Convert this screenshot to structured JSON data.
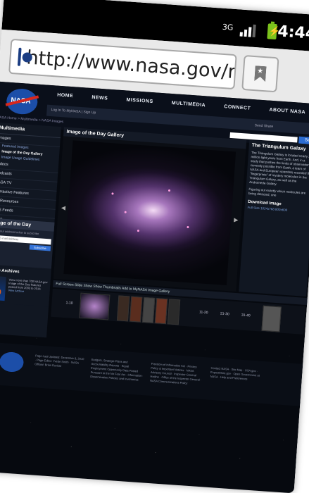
{
  "status_bar": {
    "network": "3G",
    "time": "4:44"
  },
  "browser": {
    "url": "http://www.nasa.gov/m..."
  },
  "site": {
    "logo": "NASA",
    "nav": [
      "HOME",
      "NEWS",
      "MISSIONS",
      "MULTIMEDIA",
      "CONNECT",
      "ABOUT NASA"
    ],
    "login": "Log In To MyNASA | Sign Up",
    "search_button": "Search",
    "social": "Send   Share",
    "breadcrumb": "NASA Home > Multimedia > NASA Images"
  },
  "sidebar": {
    "title": "Multimedia",
    "items": [
      "Images",
      "Videos",
      "Podcasts",
      "NASA TV",
      "Interactive Features",
      "3D Resources",
      "RSS Feeds",
      "Blogs"
    ],
    "sub_items": [
      "Featured Images",
      "Image of the Day Gallery",
      "Image Usage Guidelines"
    ]
  },
  "iotd_box": {
    "title": "Image of the Day",
    "text": "Enter your address below to subscribe",
    "input_placeholder": "Enter E-mail Address",
    "button": "Subscribe"
  },
  "archives": {
    "title": "Image Archives",
    "text": "View more than 700 NASA.gov Image of the Day features posted from 2003 to 2010.",
    "link": "View Archive"
  },
  "gallery": {
    "title": "Image of the Day Gallery",
    "toolbar": "Full Screen   Slide Show   Show Thumbnails   Add to MyNASA Image Gallery",
    "thumb_labels": [
      "1-10",
      "11-20",
      "21-30",
      "31-40"
    ]
  },
  "article": {
    "title": "The Triangulum Galaxy",
    "text": "The Triangulum Galaxy is located nearly 3 million light-years from Earth. And, in a study that pushes the limits of observations currently possible from Earth, a team of NASA and European scientists recorded the \"fingerprints\" of mystery molecules in the Triangulum Galaxy, as well as the Andromeda Galaxy.",
    "text2": "Figuring out exactly which molecules are being detected, one",
    "download_title": "Download Image",
    "links": "Full Size   1024x768   800x600"
  },
  "footer": {
    "col1": "Page Last Updated: December 8, 2010 · Page Editor: Yvette Smith · NASA Official: Brian Dunbar",
    "col2": "Budgets, Strategic Plans and Accountability Reports · Equal Employment Opportunity Data Posted Pursuant to the No Fear Act · Information-Dissemination Policies and Inventories",
    "col3": "Freedom of Information Act · Privacy Policy & Important Notices · NASA Advisory Council · Inspector General Hotline · Office of the Inspector General · NASA Communications Policy",
    "col4": "Contact NASA · Site Map · USA.gov · ExpectMore.gov · Open Government at NASA · Help and Preferences"
  }
}
